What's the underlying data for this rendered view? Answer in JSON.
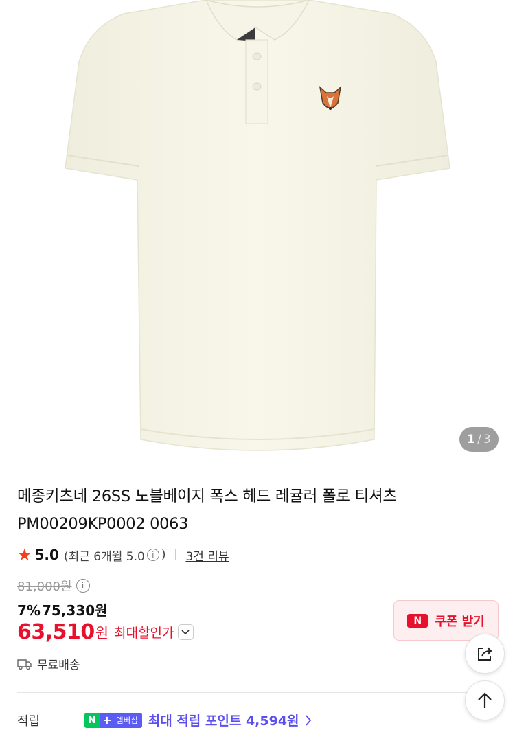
{
  "gallery": {
    "current": "1",
    "separator": "/",
    "total": "3"
  },
  "product": {
    "title_line1": "메종키츠네 26SS 노블베이지 폭스 헤드 레귤러 폴로 티셔츠",
    "title_line2": "PM00209KP0002 0063"
  },
  "rating": {
    "score": "5.0",
    "recent_prefix": "(최근 6개월 5.0",
    "recent_suffix": ")",
    "info_glyph": "i",
    "review_link": "3건 리뷰"
  },
  "price": {
    "original": "81,000원",
    "discount_pct": "7%",
    "discounted": "75,330원",
    "max_amount": "63,510",
    "max_unit": "원",
    "max_label": "최대할인가"
  },
  "coupon": {
    "badge": "N",
    "label": "쿠폰 받기"
  },
  "shipping": {
    "label": "무료배송"
  },
  "points": {
    "label": "적립",
    "badge_n": "N",
    "badge_plus": "+",
    "badge_membership": "멤버십",
    "text": "최대 적립 포인트 4,594원"
  },
  "colors": {
    "accent_red": "#e8112d",
    "naver_green": "#03c75a",
    "membership_purple": "#5b4ff0"
  },
  "icons": {
    "share": "share-icon",
    "scroll_top": "arrow-up-icon",
    "shipping": "truck-icon",
    "star": "star-icon"
  }
}
